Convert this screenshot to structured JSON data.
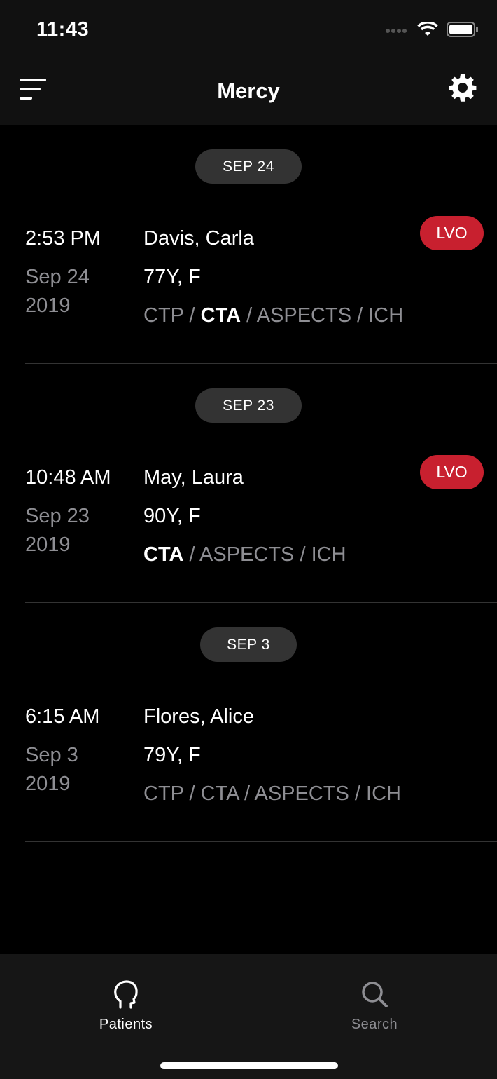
{
  "status_bar": {
    "time": "11:43"
  },
  "header": {
    "title": "Mercy"
  },
  "groups": [
    {
      "date_chip": "SEP 24",
      "patient": {
        "time": "2:53 PM",
        "date": "Sep 24",
        "year": "2019",
        "name": "Davis, Carla",
        "demographics": "77Y, F",
        "studies": [
          {
            "label": "CTP",
            "bold": false
          },
          {
            "label": "CTA",
            "bold": true
          },
          {
            "label": "ASPECTS",
            "bold": false
          },
          {
            "label": "ICH",
            "bold": false
          }
        ],
        "badge": "LVO"
      }
    },
    {
      "date_chip": "SEP 23",
      "patient": {
        "time": "10:48 AM",
        "date": "Sep 23",
        "year": "2019",
        "name": "May, Laura",
        "demographics": "90Y, F",
        "studies": [
          {
            "label": "CTA",
            "bold": true
          },
          {
            "label": "ASPECTS",
            "bold": false
          },
          {
            "label": "ICH",
            "bold": false
          }
        ],
        "badge": "LVO"
      }
    },
    {
      "date_chip": "SEP 3",
      "patient": {
        "time": "6:15 AM",
        "date": "Sep 3",
        "year": "2019",
        "name": "Flores, Alice",
        "demographics": "79Y, F",
        "studies": [
          {
            "label": "CTP",
            "bold": false
          },
          {
            "label": "CTA",
            "bold": false
          },
          {
            "label": "ASPECTS",
            "bold": false
          },
          {
            "label": "ICH",
            "bold": false
          }
        ],
        "badge": null
      }
    }
  ],
  "tab_bar": {
    "tabs": [
      {
        "label": "Patients",
        "icon": "head-icon",
        "active": true
      },
      {
        "label": "Search",
        "icon": "search-icon",
        "active": false
      }
    ]
  },
  "colors": {
    "background": "#000000",
    "bar_background": "#111111",
    "chip_background": "#333333",
    "badge_red": "#c8202f",
    "secondary_text": "#8e8e93"
  }
}
